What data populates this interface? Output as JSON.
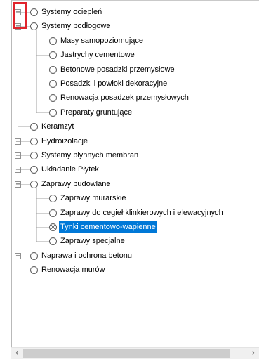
{
  "tree": {
    "items": [
      {
        "label": "Systemy ociepleń",
        "level": 0,
        "expander": "+",
        "state": "empty"
      },
      {
        "label": "Systemy podłogowe",
        "level": 0,
        "expander": "−",
        "state": "empty"
      },
      {
        "label": "Masy samopoziomujące",
        "level": 1,
        "state": "empty"
      },
      {
        "label": "Jastrychy cementowe",
        "level": 1,
        "state": "empty"
      },
      {
        "label": "Betonowe posadzki przemysłowe",
        "level": 1,
        "state": "empty"
      },
      {
        "label": "Posadzki i powłoki dekoracyjne",
        "level": 1,
        "state": "empty"
      },
      {
        "label": "Renowacja posadzek przemysłowych",
        "level": 1,
        "state": "empty"
      },
      {
        "label": "Preparaty gruntujące",
        "level": 1,
        "state": "empty"
      },
      {
        "label": "Keramzyt",
        "level": 0,
        "state": "empty"
      },
      {
        "label": "Hydroizolacje",
        "level": 0,
        "expander": "+",
        "state": "empty"
      },
      {
        "label": "Systemy płynnych membran",
        "level": 0,
        "expander": "+",
        "state": "empty"
      },
      {
        "label": "Układanie Płytek",
        "level": 0,
        "expander": "+",
        "state": "empty"
      },
      {
        "label": "Zaprawy budowlane",
        "level": 0,
        "expander": "−",
        "state": "empty"
      },
      {
        "label": "Zaprawy murarskie",
        "level": 1,
        "state": "empty"
      },
      {
        "label": "Zaprawy do cegieł klinkierowych i elewacyjnych",
        "level": 1,
        "state": "empty"
      },
      {
        "label": "Tynki cementowo-wapienne",
        "level": 1,
        "state": "excluded",
        "selected": true
      },
      {
        "label": "Zaprawy specjalne",
        "level": 1,
        "state": "empty"
      },
      {
        "label": "Naprawa i ochrona betonu",
        "level": 0,
        "expander": "+",
        "state": "empty"
      },
      {
        "label": "Renowacja murów",
        "level": 0,
        "state": "empty"
      }
    ]
  },
  "scrollbar": {
    "left_icon": "‹",
    "right_icon": "›"
  },
  "colors": {
    "selection": "#0078d7",
    "highlight_box": "#e0242c",
    "tree_lines": "#a0a0a0"
  }
}
